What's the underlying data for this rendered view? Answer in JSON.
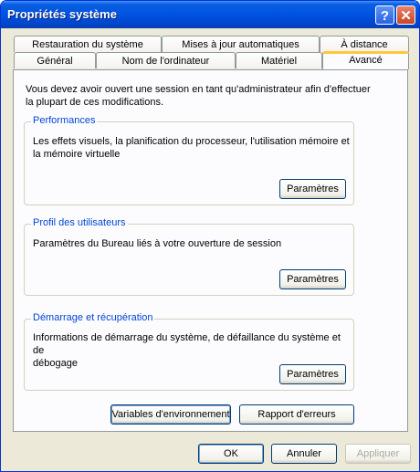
{
  "window": {
    "title": "Propriétés système"
  },
  "titlebar_buttons": {
    "help": "?",
    "close": "✕"
  },
  "tabs_row1": [
    "Restauration du système",
    "Mises à jour automatiques",
    "À distance"
  ],
  "tabs_row2": [
    "Général",
    "Nom de l'ordinateur",
    "Matériel",
    "Avancé"
  ],
  "active_tab": "Avancé",
  "intro": [
    "Vous devez avoir ouvert une session en tant qu'administrateur afin d'effectuer",
    "la plupart de ces modifications."
  ],
  "groups": {
    "performances": {
      "label": "Performances",
      "desc": [
        "Les effets visuels, la planification du processeur, l'utilisation mémoire et",
        "la mémoire virtuelle"
      ],
      "button": "Paramètres"
    },
    "profil": {
      "label": "Profil des utilisateurs",
      "desc": [
        "Paramètres du Bureau liés à votre ouverture de session"
      ],
      "button": "Paramètres"
    },
    "demarrage": {
      "label": "Démarrage et récupération",
      "desc": [
        "Informations de démarrage du système, de défaillance du système et de",
        "débogage"
      ],
      "button": "Paramètres"
    }
  },
  "panel_buttons": {
    "env": "Variables d'environnement",
    "errors": "Rapport d'erreurs"
  },
  "footer": {
    "ok": "OK",
    "cancel": "Annuler",
    "apply": "Appliquer"
  }
}
